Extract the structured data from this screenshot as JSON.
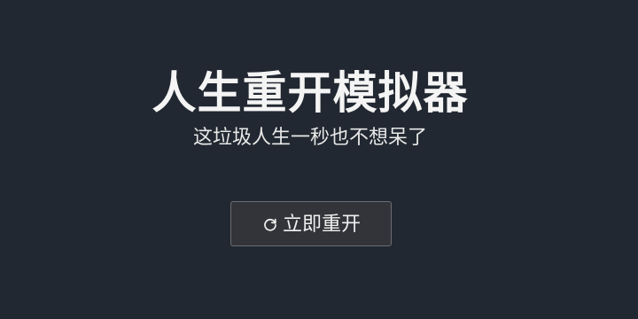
{
  "page": {
    "title": "人生重开模拟器",
    "subtitle": "这垃圾人生一秒也不想呆了"
  },
  "actions": {
    "restart_label": "立即重开",
    "restart_icon": "refresh-icon"
  },
  "colors": {
    "background": "#222831",
    "button_background": "#323439",
    "button_border": "#6a6d72",
    "text": "#f2f2f2"
  }
}
